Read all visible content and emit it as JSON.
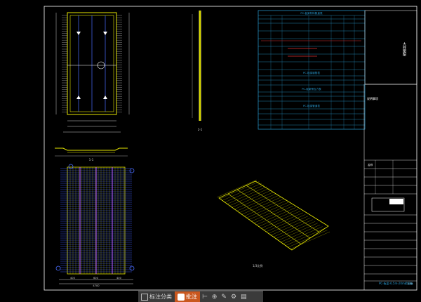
{
  "drawing": {
    "sheet_title": "PC-板梁-6.5m-20m桥面板",
    "vertical_note": "大样图配",
    "label_iso": "1/3比例",
    "label_section": "1-1",
    "label_section2": "2-1",
    "dim_left": "400",
    "dim_center": "600",
    "dim_right": "400",
    "dim_total": "4700",
    "note_box": "说明事项",
    "table1_title": "PC-板梁材料数量表",
    "table2_title": "PC-板梁钢筋表",
    "table3_title": "PC-板梁预应力表",
    "table4_title": "PC-板梁管道表",
    "title_block_label": "名称",
    "title_block_ratio": "1:50"
  },
  "toolbar": {
    "btn1_label": "标注分类",
    "btn2_label": "批注",
    "colors": {
      "bar": "#3b3b3b",
      "active": "#c9571e"
    }
  }
}
